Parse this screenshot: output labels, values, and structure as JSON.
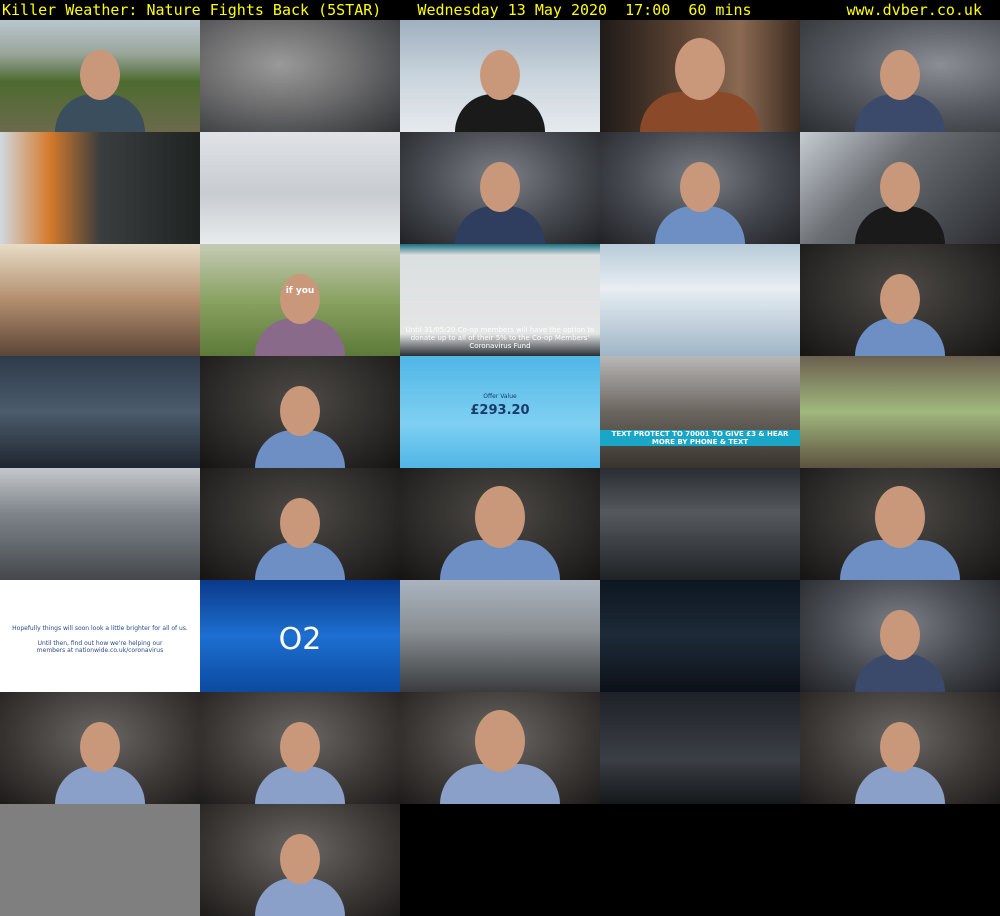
{
  "header": {
    "title": "Killer Weather: Nature Fights Back (5STAR)    Wednesday 13 May 2020  17:00  60 mins",
    "site": "www.dvber.co.uk"
  },
  "colors": {
    "header_text": "#ffff00",
    "background": "#000000"
  },
  "thumbnails": [
    {
      "scene": "man walking on country path"
    },
    {
      "scene": "stormy grey landscape"
    },
    {
      "scene": "person walking in snowstorm"
    },
    {
      "scene": "man holding phone close-up"
    },
    {
      "scene": "man with glasses interview"
    },
    {
      "scene": "orange object in storm"
    },
    {
      "scene": "snowy park with trees"
    },
    {
      "scene": "man with glasses interview"
    },
    {
      "scene": "man in blue shirt interview"
    },
    {
      "scene": "hooded figure in storm"
    },
    {
      "scene": "child exercising at home"
    },
    {
      "scene": "woman in park advert",
      "caption": "if you"
    },
    {
      "scene": "video call advert",
      "caption": "Until 31/05/20 Co-op members will have the option to donate up to all of their 5% to the Co-op Members' Coronavirus Fund"
    },
    {
      "scene": "aerial clouds with plane"
    },
    {
      "scene": "man in blue shirt interview"
    },
    {
      "scene": "helicopter window in rain"
    },
    {
      "scene": "man in blue shirt interview"
    },
    {
      "scene": "offer value advert",
      "caption": "£293.20",
      "subcaption": "Offer Value"
    },
    {
      "scene": "flood aftermath appeal",
      "caption": "TEXT PROTECT TO 70001 TO GIVE £3 & HEAR MORE BY PHONE & TEXT"
    },
    {
      "scene": "family looking out window"
    },
    {
      "scene": "misty stormy hills"
    },
    {
      "scene": "man in blue shirt interview"
    },
    {
      "scene": "man in blue shirt close-up"
    },
    {
      "scene": "aircraft cabin interior"
    },
    {
      "scene": "man in blue shirt close-up"
    },
    {
      "scene": "nationwide advert",
      "caption": "Hopefully things will soon look a little brighter for all of us.",
      "caption2": "Until then, find out how we're helping our members at nationwide.co.uk/coronavirus"
    },
    {
      "scene": "O2 advert",
      "caption": "O2"
    },
    {
      "scene": "ambulance car on road"
    },
    {
      "scene": "cockpit view in storm"
    },
    {
      "scene": "man with glasses interview"
    },
    {
      "scene": "man in checked shirt interview"
    },
    {
      "scene": "man in checked shirt interview"
    },
    {
      "scene": "man in checked shirt close-up"
    },
    {
      "scene": "truck at night on road"
    },
    {
      "scene": "man in checked shirt interview"
    },
    {
      "scene": "blank grey frame"
    },
    {
      "scene": "man in checked shirt interview"
    }
  ]
}
